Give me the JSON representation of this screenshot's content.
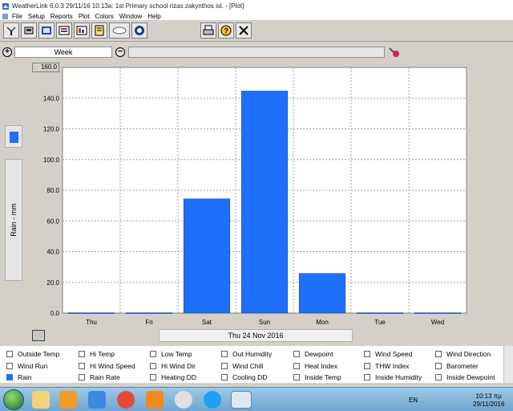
{
  "window": {
    "title": "WeatherLink 6.0.3  29/11/16  10:13a: 1st Primary school rizas zakynthos isl. - [Plot]"
  },
  "menu": [
    "File",
    "Setup",
    "Reports",
    "Plot",
    "Colors",
    "Window",
    "Help"
  ],
  "toolbar": {
    "icons": [
      "connect-icon",
      "station-icon",
      "browse-icon",
      "bulletin-icon",
      "summary-icon",
      "notes-icon",
      "weather-icon",
      "noaa-icon",
      "print-icon",
      "help-icon",
      "close-icon"
    ]
  },
  "range": {
    "period": "Week",
    "increase_symbol": "+",
    "decrease_symbol": "−"
  },
  "plot": {
    "y_axis_label": "Rain - mm",
    "date": "Thu 24 Nov 2016",
    "ylim_top_label": "160.0",
    "accent": "#1e6ffb"
  },
  "chart_data": {
    "type": "bar",
    "categories": [
      "Thu",
      "Fri",
      "Sat",
      "Sun",
      "Mon",
      "Tue",
      "Wed"
    ],
    "values": [
      0.2,
      0.2,
      74.4,
      144.6,
      25.8,
      0.2,
      0.2
    ],
    "title": "",
    "xlabel": "",
    "ylabel": "Rain - mm",
    "ylim": [
      0,
      160
    ],
    "yticks": [
      "0.0",
      "20.0",
      "40.0",
      "60.0",
      "80.0",
      "100.0",
      "120.0",
      "140.0",
      "160.0"
    ],
    "grid": true,
    "bar_color": "#1e6ffb"
  },
  "checkboxes": [
    [
      {
        "label": "Outside Temp",
        "checked": false
      },
      {
        "label": "Hi Temp",
        "checked": false
      },
      {
        "label": "Low Temp",
        "checked": false
      },
      {
        "label": "Out Humidity",
        "checked": false
      },
      {
        "label": "Dewpoint",
        "checked": false
      },
      {
        "label": "Wind Speed",
        "checked": false
      },
      {
        "label": "Wind Direction",
        "checked": false
      }
    ],
    [
      {
        "label": "Wind Run",
        "checked": false
      },
      {
        "label": "Hi Wind Speed",
        "checked": false
      },
      {
        "label": "Hi Wind Dir",
        "checked": false
      },
      {
        "label": "Wind Chill",
        "checked": false
      },
      {
        "label": "Heat Index",
        "checked": false
      },
      {
        "label": "THW Index",
        "checked": false
      },
      {
        "label": "Barometer",
        "checked": false
      }
    ],
    [
      {
        "label": "Rain",
        "checked": true
      },
      {
        "label": "Rain Rate",
        "checked": false
      },
      {
        "label": "Heating DD",
        "checked": false
      },
      {
        "label": "Cooling DD",
        "checked": false
      },
      {
        "label": "Inside Temp",
        "checked": false
      },
      {
        "label": "Inside Humidity",
        "checked": false
      },
      {
        "label": "Inside Dewpoint",
        "checked": false
      }
    ]
  ],
  "taskbar": {
    "language": "EN",
    "time": "10:13 πμ",
    "date": "29/11/2016"
  }
}
